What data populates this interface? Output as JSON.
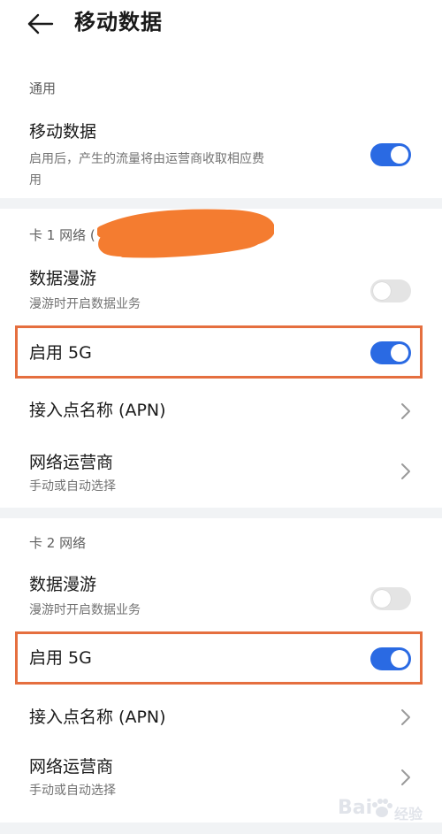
{
  "header": {
    "title": "移动数据"
  },
  "general": {
    "section_title": "通用",
    "mobile_data": {
      "title": "移动数据",
      "subtitle_line1": "启用后，产生的流量将由运营商收取相应费",
      "subtitle_line2": "用",
      "enabled": true
    }
  },
  "sim1": {
    "section_title": "卡 1 网络 (",
    "roaming": {
      "title": "数据漫游",
      "subtitle": "漫游时开启数据业务",
      "enabled": false
    },
    "enable_5g": {
      "title": "启用 5G",
      "enabled": true
    },
    "apn": {
      "title": "接入点名称 (APN)"
    },
    "carrier": {
      "title": "网络运营商",
      "subtitle": "手动或自动选择"
    }
  },
  "sim2": {
    "section_title": "卡 2 网络",
    "roaming": {
      "title": "数据漫游",
      "subtitle": "漫游时开启数据业务",
      "enabled": false
    },
    "enable_5g": {
      "title": "启用 5G",
      "enabled": true
    },
    "apn": {
      "title": "接入点名称 (APN)"
    },
    "carrier": {
      "title": "网络运营商",
      "subtitle": "手动或自动选择"
    }
  },
  "watermark": {
    "text_latin": "Bai",
    "text_cn": "经验"
  },
  "colors": {
    "toggle_on": "#2a6ae3",
    "toggle_off": "#e4e4e4",
    "highlight": "#e56f3f",
    "redaction": "#f47c30",
    "background": "#f1f3f5"
  }
}
